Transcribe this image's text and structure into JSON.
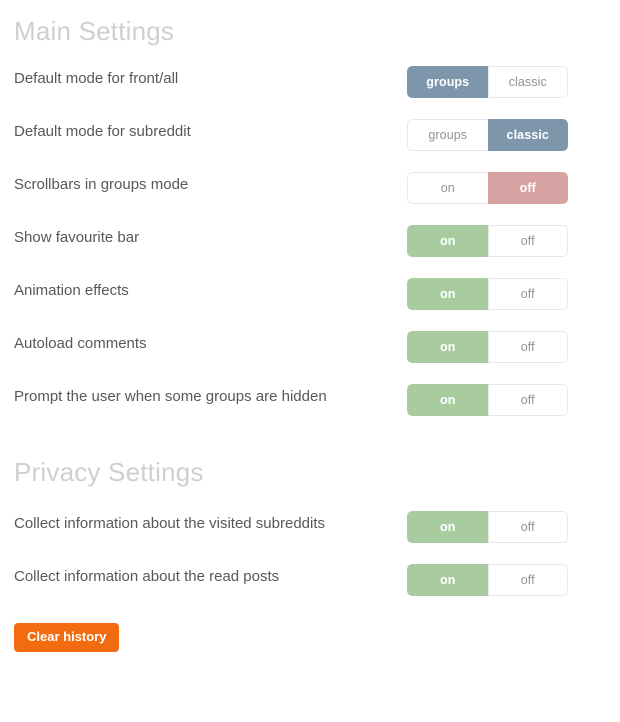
{
  "colors": {
    "heading": "#cfcfcf",
    "label": "#585858",
    "toggle_blue": "#7d96ab",
    "toggle_green": "#a8cba0",
    "toggle_red": "#d9a2a2",
    "toggle_inactive_text": "#8e9599",
    "toggle_border": "#e6e8ea",
    "button_orange": "#f26b0f",
    "background": "#ffffff"
  },
  "main_settings": {
    "heading": "Main Settings",
    "rows": [
      {
        "label": "Default mode for front/all",
        "left_label": "groups",
        "right_label": "classic",
        "active": "left",
        "accent": "blue"
      },
      {
        "label": "Default mode for subreddit",
        "left_label": "groups",
        "right_label": "classic",
        "active": "right",
        "accent": "blue"
      },
      {
        "label": "Scrollbars in groups mode",
        "left_label": "on",
        "right_label": "off",
        "active": "right",
        "accent": "red"
      },
      {
        "label": "Show favourite bar",
        "left_label": "on",
        "right_label": "off",
        "active": "left",
        "accent": "green"
      },
      {
        "label": "Animation effects",
        "left_label": "on",
        "right_label": "off",
        "active": "left",
        "accent": "green"
      },
      {
        "label": "Autoload comments",
        "left_label": "on",
        "right_label": "off",
        "active": "left",
        "accent": "green"
      },
      {
        "label": "Prompt the user when some groups are hidden",
        "left_label": "on",
        "right_label": "off",
        "active": "left",
        "accent": "green"
      }
    ]
  },
  "privacy_settings": {
    "heading": "Privacy Settings",
    "rows": [
      {
        "label": "Collect information about the visited subreddits",
        "left_label": "on",
        "right_label": "off",
        "active": "left",
        "accent": "green"
      },
      {
        "label": "Collect information about the read posts",
        "left_label": "on",
        "right_label": "off",
        "active": "left",
        "accent": "green"
      }
    ],
    "clear_history_label": "Clear history"
  }
}
